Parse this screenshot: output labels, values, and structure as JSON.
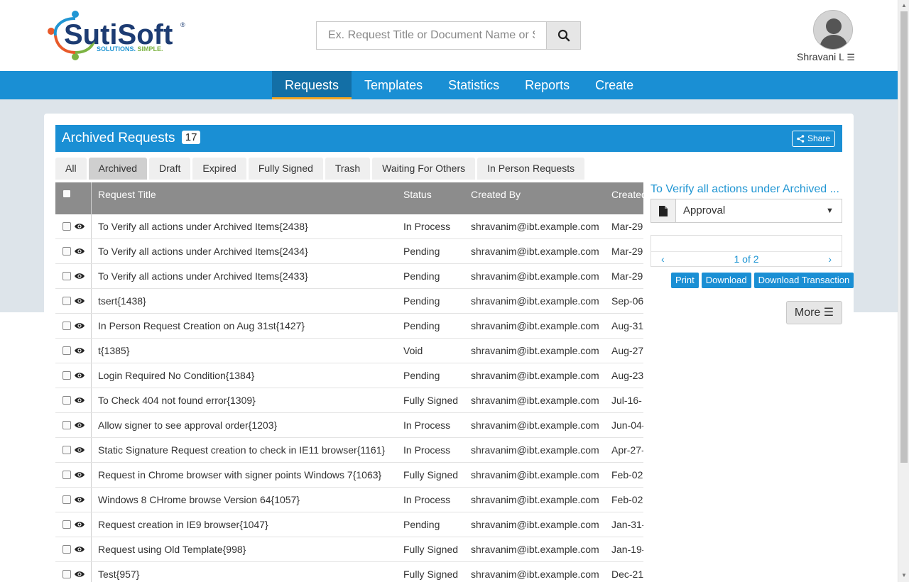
{
  "brand": {
    "name_part1": "Suti",
    "name_part2": "Soft",
    "tagline1": "SOLUTIONS.",
    "tagline2": "SIMPLE."
  },
  "search": {
    "placeholder": "Ex. Request Title or Document Name or S"
  },
  "user": {
    "name": "Shravani L"
  },
  "nav": [
    {
      "label": "Requests",
      "active": true
    },
    {
      "label": "Templates"
    },
    {
      "label": "Statistics"
    },
    {
      "label": "Reports"
    },
    {
      "label": "Create"
    }
  ],
  "panel": {
    "title": "Archived Requests",
    "count": "17",
    "share_label": "Share"
  },
  "tabs": [
    "All",
    "Archived",
    "Draft",
    "Expired",
    "Fully Signed",
    "Trash",
    "Waiting For Others",
    "In Person Requests"
  ],
  "table": {
    "headers": {
      "title": "Request Title",
      "status": "Status",
      "created_by": "Created By",
      "created": "Created"
    },
    "rows": [
      {
        "title": "To Verify all actions under Archived Items{2438}",
        "status": "In Process",
        "by": "shravanim@ibt.example.com",
        "date": "Mar-29"
      },
      {
        "title": "To Verify all actions under Archived Items{2434}",
        "status": "Pending",
        "by": "shravanim@ibt.example.com",
        "date": "Mar-29"
      },
      {
        "title": "To Verify all actions under Archived Items{2433}",
        "status": "Pending",
        "by": "shravanim@ibt.example.com",
        "date": "Mar-29"
      },
      {
        "title": "tsert{1438}",
        "status": "Pending",
        "by": "shravanim@ibt.example.com",
        "date": "Sep-06"
      },
      {
        "title": "In Person Request Creation on Aug 31st{1427}",
        "status": "Pending",
        "by": "shravanim@ibt.example.com",
        "date": "Aug-31"
      },
      {
        "title": "t{1385}",
        "status": "Void",
        "by": "shravanim@ibt.example.com",
        "date": "Aug-27"
      },
      {
        "title": "Login Required No Condition{1384}",
        "status": "Pending",
        "by": "shravanim@ibt.example.com",
        "date": "Aug-23"
      },
      {
        "title": "To Check 404 not found error{1309}",
        "status": "Fully Signed",
        "by": "shravanim@ibt.example.com",
        "date": "Jul-16-"
      },
      {
        "title": "Allow signer to see approval order{1203}",
        "status": "In Process",
        "by": "shravanim@ibt.example.com",
        "date": "Jun-04-"
      },
      {
        "title": "Static Signature Request creation to check in IE11 browser{1161}",
        "status": "In Process",
        "by": "shravanim@ibt.example.com",
        "date": "Apr-27-"
      },
      {
        "title": "Request in Chrome browser with signer points Windows 7{1063}",
        "status": "Fully Signed",
        "by": "shravanim@ibt.example.com",
        "date": "Feb-02"
      },
      {
        "title": "Windows 8 CHrome browse Version 64{1057}",
        "status": "In Process",
        "by": "shravanim@ibt.example.com",
        "date": "Feb-02"
      },
      {
        "title": "Request creation in IE9 browser{1047}",
        "status": "Pending",
        "by": "shravanim@ibt.example.com",
        "date": "Jan-31-"
      },
      {
        "title": "Request using Old Template{998}",
        "status": "Fully Signed",
        "by": "shravanim@ibt.example.com",
        "date": "Jan-19-"
      },
      {
        "title": "Test{957}",
        "status": "Fully Signed",
        "by": "shravanim@ibt.example.com",
        "date": "Dec-21"
      }
    ]
  },
  "detail": {
    "title": "To Verify all actions under Archived ...",
    "select_value": "Approval",
    "page_text": "1 of 2",
    "actions": [
      "Print",
      "Download",
      "Download Transaction"
    ],
    "more_label": "More"
  },
  "colors": {
    "primary": "#1a8fd4",
    "nav_active": "#136fa6",
    "accent": "#f5a623",
    "header_gray": "#8c8c8c"
  }
}
